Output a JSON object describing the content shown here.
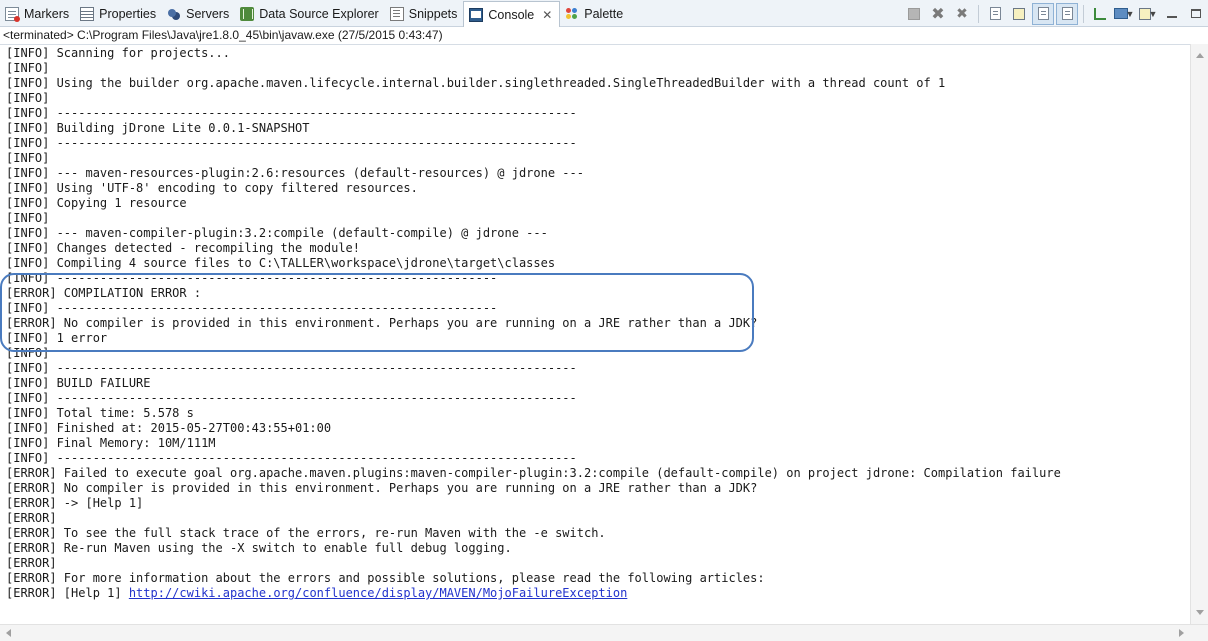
{
  "tabs": [
    {
      "label": "Markers",
      "icon": "markers-icon"
    },
    {
      "label": "Properties",
      "icon": "properties-icon"
    },
    {
      "label": "Servers",
      "icon": "servers-icon"
    },
    {
      "label": "Data Source Explorer",
      "icon": "data-source-explorer-icon"
    },
    {
      "label": "Snippets",
      "icon": "snippets-icon"
    },
    {
      "label": "Console",
      "icon": "console-icon",
      "active": true,
      "close": "✕"
    },
    {
      "label": "Palette",
      "icon": "palette-icon"
    }
  ],
  "status": "<terminated> C:\\Program Files\\Java\\jre1.8.0_45\\bin\\javaw.exe (27/5/2015 0:43:47)",
  "console_lines": [
    "[INFO] Scanning for projects...",
    "[INFO]",
    "[INFO] Using the builder org.apache.maven.lifecycle.internal.builder.singlethreaded.SingleThreadedBuilder with a thread count of 1",
    "[INFO]",
    "[INFO] ------------------------------------------------------------------------",
    "[INFO] Building jDrone Lite 0.0.1-SNAPSHOT",
    "[INFO] ------------------------------------------------------------------------",
    "[INFO]",
    "[INFO] --- maven-resources-plugin:2.6:resources (default-resources) @ jdrone ---",
    "[INFO] Using 'UTF-8' encoding to copy filtered resources.",
    "[INFO] Copying 1 resource",
    "[INFO]",
    "[INFO] --- maven-compiler-plugin:3.2:compile (default-compile) @ jdrone ---",
    "[INFO] Changes detected - recompiling the module!",
    "[INFO] Compiling 4 source files to C:\\TALLER\\workspace\\jdrone\\target\\classes",
    "[INFO] -------------------------------------------------------------",
    "[ERROR] COMPILATION ERROR :",
    "[INFO] -------------------------------------------------------------",
    "[ERROR] No compiler is provided in this environment. Perhaps you are running on a JRE rather than a JDK?",
    "[INFO] 1 error",
    "[INFO]",
    "[INFO] ------------------------------------------------------------------------",
    "[INFO] BUILD FAILURE",
    "[INFO] ------------------------------------------------------------------------",
    "[INFO] Total time: 5.578 s",
    "[INFO] Finished at: 2015-05-27T00:43:55+01:00",
    "[INFO] Final Memory: 10M/111M",
    "[INFO] ------------------------------------------------------------------------",
    "[ERROR] Failed to execute goal org.apache.maven.plugins:maven-compiler-plugin:3.2:compile (default-compile) on project jdrone: Compilation failure",
    "[ERROR] No compiler is provided in this environment. Perhaps you are running on a JRE rather than a JDK?",
    "[ERROR] -> [Help 1]",
    "[ERROR]",
    "[ERROR] To see the full stack trace of the errors, re-run Maven with the -e switch.",
    "[ERROR] Re-run Maven using the -X switch to enable full debug logging.",
    "[ERROR]",
    "[ERROR] For more information about the errors and possible solutions, please read the following articles:"
  ],
  "last_line": {
    "prefix": "[ERROR] [Help 1] ",
    "link": "http://cwiki.apache.org/confluence/display/MAVEN/MojoFailureException"
  },
  "toolbar_icons": [
    "terminate-icon",
    "remove-launch-icon",
    "remove-all-terminated-icon",
    "clear-console-icon",
    "scroll-lock-icon",
    "show-on-stdout-icon",
    "show-on-stderr-icon",
    "pin-console-icon",
    "display-selected-console-icon",
    "open-console-icon",
    "minimize-icon",
    "maximize-icon"
  ],
  "colors": {
    "highlight": "#4a7bbf",
    "link": "#2233cc",
    "tabbar": "#eef3f8"
  }
}
